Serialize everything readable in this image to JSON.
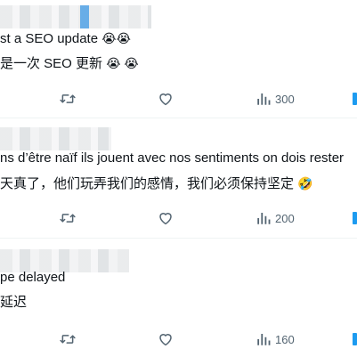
{
  "posts": [
    {
      "text_en": "st a SEO update",
      "text_en_emoji": "😭😭",
      "text_zh": "是一次 SEO 更新",
      "text_zh_emoji": "😭 😭",
      "views": "300"
    },
    {
      "text_en": "ns d’être naïf ils jouent avec nos sentiments on dois rester",
      "text_zh": "天真了，他们玩弄我们的感情，我们必须保持坚定",
      "text_zh_emoji": "🤣",
      "views": "200"
    },
    {
      "text_en": "pe delayed",
      "text_zh": "延迟",
      "views": "160"
    }
  ],
  "icons": {
    "retweet": "retweet-icon",
    "like": "heart-icon",
    "views": "bar-chart-icon"
  },
  "colors": {
    "text": "#0f1419",
    "icon": "#536471",
    "divider": "#eff3f4",
    "accent": "#1d9bf0"
  }
}
